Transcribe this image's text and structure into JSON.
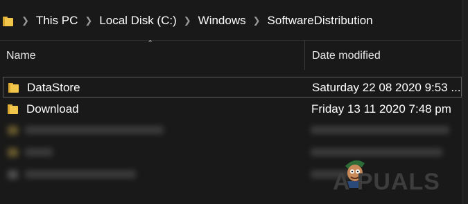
{
  "breadcrumb": {
    "items": [
      "This PC",
      "Local Disk (C:)",
      "Windows",
      "SoftwareDistribution"
    ]
  },
  "columns": {
    "name": "Name",
    "date_modified": "Date modified"
  },
  "files": [
    {
      "name": "DataStore",
      "date": "Saturday 22 08 2020 9:53 ...",
      "selected": true
    },
    {
      "name": "Download",
      "date": "Friday 13 11 2020 7:48 pm",
      "selected": false
    }
  ],
  "watermark": "A PUALS",
  "icons": {
    "folder": "folder-icon",
    "separator": "chevron-right-icon",
    "sort": "sort-up-icon"
  },
  "colors": {
    "background": "#191919",
    "folder": "#f2c54b",
    "text": "#ffffff"
  }
}
